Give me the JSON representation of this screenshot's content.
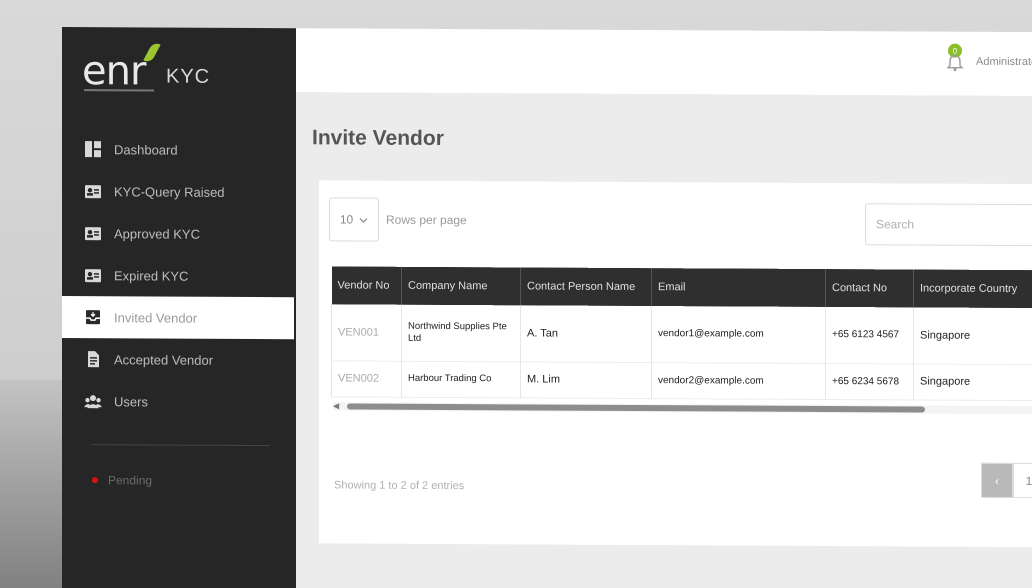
{
  "brand": {
    "logo_main": "enr",
    "logo_product": "KYC",
    "accent_color": "#9bc531"
  },
  "sidebar": {
    "items": [
      {
        "label": "Dashboard",
        "icon": "dashboard-icon"
      },
      {
        "label": "KYC-Query Raised",
        "icon": "id-card-icon"
      },
      {
        "label": "Approved KYC",
        "icon": "id-card-icon"
      },
      {
        "label": "Expired KYC",
        "icon": "id-card-icon"
      },
      {
        "label": "Invited Vendor",
        "icon": "inbox-icon",
        "active": true
      },
      {
        "label": "Accepted Vendor",
        "icon": "document-icon"
      },
      {
        "label": "Users",
        "icon": "users-icon"
      }
    ],
    "pending_label": "Pending"
  },
  "topbar": {
    "notification_count": "0",
    "user_label": "Administrator"
  },
  "main": {
    "page_title": "Invite Vendor",
    "rows_per_page_value": "10",
    "rows_per_page_label": "Rows per page",
    "search_placeholder": "Search",
    "table": {
      "headers": [
        "Vendor No",
        "Company Name",
        "Contact Person Name",
        "Email",
        "Contact No",
        "Incorporate Country"
      ],
      "rows": [
        {
          "vendor_no": "VEN001",
          "company": "Northwind Supplies Pte Ltd",
          "contact_person": "A. Tan",
          "email": "vendor1@example.com",
          "contact_no": "+65 6123 4567",
          "country": "Singapore"
        },
        {
          "vendor_no": "VEN002",
          "company": "Harbour Trading Co",
          "contact_person": "M. Lim",
          "email": "vendor2@example.com",
          "contact_no": "+65 6234 5678",
          "country": "Singapore"
        }
      ]
    },
    "showing_text": "Showing 1 to 2 of 2 entries",
    "pager": {
      "prev": "‹",
      "page": "1"
    }
  }
}
